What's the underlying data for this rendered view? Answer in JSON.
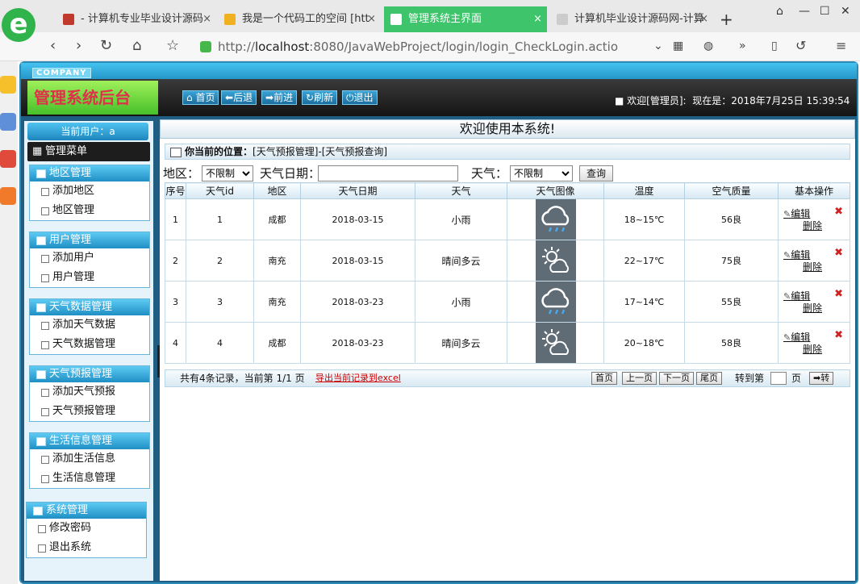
{
  "browser": {
    "tabs": [
      {
        "label": "- 计算机专业毕业设计源码",
        "fav": "#c0392b"
      },
      {
        "label": "我是一个代码工的空间 [htt",
        "fav": "#f0b020"
      },
      {
        "label": "管理系统主界面",
        "fav": "#ffffff"
      },
      {
        "label": "计算机毕业设计源码网-计算",
        "fav": "#cccccc"
      }
    ],
    "close_glyph": "×",
    "new_tab": "+",
    "url_prefix": "http://",
    "url_host": "localhost",
    "url_rest": ":8080/JavaWebProject/login/login_CheckLogin.actio"
  },
  "app": {
    "company": "COMPANY",
    "title": "管理系统后台",
    "nav": [
      "首页",
      "后退",
      "前进",
      "刷新",
      "退出"
    ],
    "welcome": "欢迎[管理员]:",
    "now": "现在是：2018年7月25日 15:39:54"
  },
  "sidebar": {
    "current_user": "当前用户：a",
    "menu_title": "管理菜单",
    "groups": [
      {
        "title": "地区管理",
        "items": [
          "添加地区",
          "地区管理"
        ]
      },
      {
        "title": "用户管理",
        "items": [
          "添加用户",
          "用户管理"
        ]
      },
      {
        "title": "天气数据管理",
        "items": [
          "添加天气数据",
          "天气数据管理"
        ]
      },
      {
        "title": "天气预报管理",
        "items": [
          "添加天气预报",
          "天气预报管理"
        ]
      },
      {
        "title": "生活信息管理",
        "items": [
          "添加生活信息",
          "生活信息管理"
        ]
      },
      {
        "title": "系统管理",
        "items": [
          "修改密码",
          "退出系统"
        ]
      }
    ]
  },
  "main": {
    "welcome": "欢迎使用本系统!",
    "position_label": "你当前的位置：",
    "position_path": "[天气预报管理]-[天气预报查询]",
    "filter": {
      "region_label": "地区：",
      "region_value": "不限制",
      "date_label": "天气日期：",
      "date_value": "",
      "weather_label": "天气：",
      "weather_value": "不限制",
      "query": "查询"
    },
    "columns": [
      "序号",
      "天气id",
      "地区",
      "天气日期",
      "天气",
      "天气图像",
      "温度",
      "空气质量",
      "基本操作"
    ],
    "rows": [
      {
        "no": "1",
        "id": "1",
        "region": "成都",
        "date": "2018-03-15",
        "weather": "小雨",
        "icon": "rain-cloud-icon",
        "temp": "18~15℃",
        "air": "56良"
      },
      {
        "no": "2",
        "id": "2",
        "region": "南充",
        "date": "2018-03-15",
        "weather": "晴间多云",
        "icon": "sun-cloud-icon",
        "temp": "22~17℃",
        "air": "75良"
      },
      {
        "no": "3",
        "id": "3",
        "region": "南充",
        "date": "2018-03-23",
        "weather": "小雨",
        "icon": "rain-cloud-icon",
        "temp": "17~14℃",
        "air": "55良"
      },
      {
        "no": "4",
        "id": "4",
        "region": "成都",
        "date": "2018-03-23",
        "weather": "晴间多云",
        "icon": "sun-cloud-icon",
        "temp": "20~18℃",
        "air": "58良"
      }
    ],
    "edit": "编辑",
    "del": "删除",
    "pager": {
      "summary": "共有4条记录，当前第 1/1 页",
      "export": "导出当前记录到excel",
      "first": "首页",
      "prev": "上一页",
      "next": "下一页",
      "last": "尾页",
      "goto": "转到第",
      "page": "页",
      "go": "转"
    }
  }
}
